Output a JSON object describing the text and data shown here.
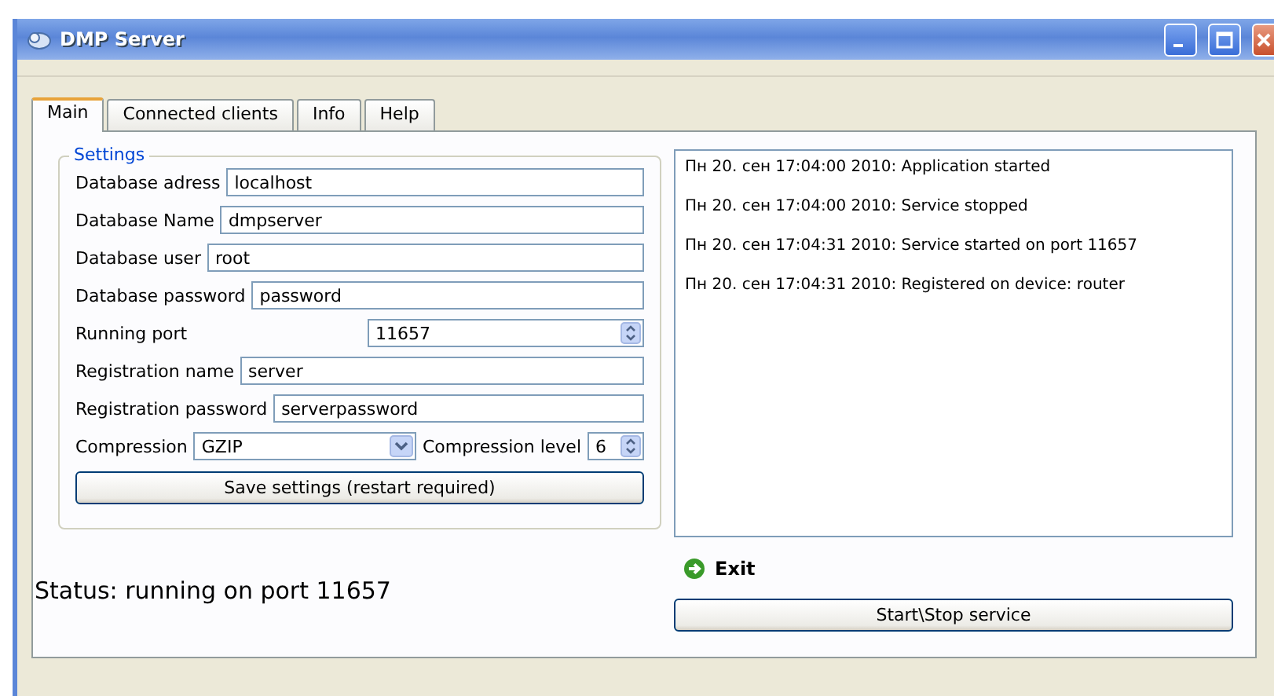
{
  "window": {
    "title": "DMP Server"
  },
  "tabs": [
    {
      "label": "Main",
      "selected": true
    },
    {
      "label": "Connected clients",
      "selected": false
    },
    {
      "label": "Info",
      "selected": false
    },
    {
      "label": "Help",
      "selected": false
    }
  ],
  "settings": {
    "title": "Settings",
    "fields": [
      {
        "kind": "text",
        "label": "Database adress",
        "value": "localhost"
      },
      {
        "kind": "text",
        "label": "Database Name",
        "value": "dmpserver"
      },
      {
        "kind": "text",
        "label": "Database user",
        "value": "root"
      },
      {
        "kind": "text",
        "label": "Database password",
        "value": "password"
      },
      {
        "kind": "spin",
        "label": "Running port",
        "value": "11657"
      },
      {
        "kind": "text",
        "label": "Registration name",
        "value": "server"
      },
      {
        "kind": "text",
        "label": "Registration password",
        "value": "serverpassword"
      }
    ],
    "compression": {
      "label": "Compression",
      "value": "GZIP",
      "level_label": "Compression level",
      "level_value": "6"
    },
    "save_button": "Save settings (restart required)"
  },
  "status": "Status: running on port 11657",
  "log": [
    "Пн 20. сен 17:04:00 2010: Application started",
    "Пн 20. сен 17:04:00 2010: Service stopped",
    "Пн 20. сен 17:04:31 2010: Service started on port 11657",
    "Пн 20. сен 17:04:31 2010: Registered on device: router"
  ],
  "exit": "Exit",
  "service_button": "Start\\Stop service"
}
